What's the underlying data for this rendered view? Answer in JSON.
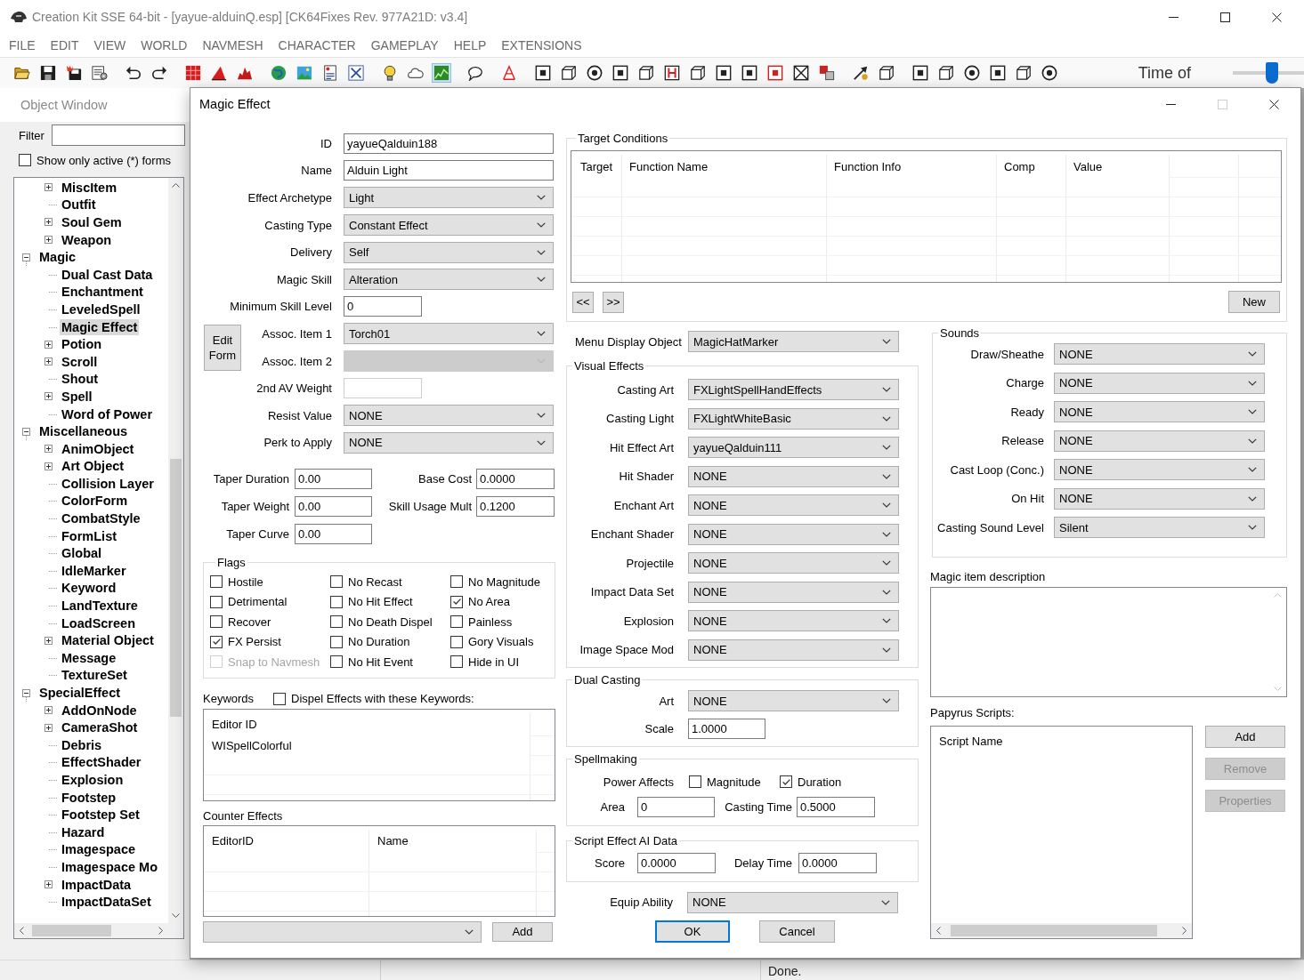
{
  "window": {
    "title": "Creation Kit SSE 64-bit - [yayue-alduinQ.esp] [CK64Fixes Rev. 977A21D: v3.4]"
  },
  "menu": [
    "FILE",
    "EDIT",
    "VIEW",
    "WORLD",
    "NAVMESH",
    "CHARACTER",
    "GAMEPLAY",
    "HELP",
    "EXTENSIONS"
  ],
  "toolbar": {
    "buttons": [
      {
        "pressed": false
      },
      {
        "pressed": false
      },
      {
        "pressed": false
      },
      {
        "pressed": false
      },
      {
        "pressed": false
      },
      {
        "pressed": false
      },
      {
        "pressed": false
      },
      {
        "pressed": false
      },
      {
        "pressed": false
      },
      {
        "pressed": false
      },
      {
        "pressed": false
      },
      {
        "pressed": false
      },
      {
        "pressed": false
      },
      {
        "pressed": false
      },
      {
        "pressed": false
      },
      {
        "pressed": true
      },
      {
        "pressed": false
      },
      {
        "pressed": false
      },
      {
        "pressed": false
      },
      {
        "pressed": false
      },
      {
        "pressed": false
      },
      {
        "pressed": false
      },
      {
        "pressed": false
      },
      {
        "pressed": false
      },
      {
        "pressed": false
      },
      {
        "pressed": false
      },
      {
        "pressed": false
      },
      {
        "pressed": false
      },
      {
        "pressed": false
      },
      {
        "pressed": false
      },
      {
        "pressed": false
      },
      {
        "pressed": false
      },
      {
        "pressed": false
      },
      {
        "pressed": false
      },
      {
        "pressed": false
      },
      {
        "pressed": false
      },
      {
        "pressed": false
      },
      {
        "pressed": false
      }
    ],
    "time_label": "Time of",
    "time_slider": {
      "level": 0.55
    }
  },
  "object_window": {
    "title": "Object Window",
    "filter": {
      "label": "Filter"
    },
    "active_only": {
      "label": "Show only active (*) forms",
      "checked": false
    },
    "tree": {
      "continued_items": [
        {
          "label": "MiscItem",
          "collapsed": true,
          "expanded": false,
          "selected": false
        },
        {
          "label": "Outfit",
          "collapsed": false,
          "expanded": false,
          "selected": false
        },
        {
          "label": "Soul Gem",
          "collapsed": true,
          "expanded": false,
          "selected": false
        },
        {
          "label": "Weapon",
          "collapsed": true,
          "expanded": false,
          "selected": false
        }
      ],
      "items": [
        {
          "label": "Magic",
          "collapsed": false,
          "expanded": true,
          "selected": false,
          "children": [
            {
              "label": "Dual Cast Data",
              "collapsed": false,
              "expanded": false,
              "selected": false
            },
            {
              "label": "Enchantment",
              "collapsed": false,
              "expanded": false,
              "selected": false
            },
            {
              "label": "LeveledSpell",
              "collapsed": false,
              "expanded": false,
              "selected": false
            },
            {
              "label": "Magic Effect",
              "collapsed": false,
              "expanded": false,
              "selected": true
            },
            {
              "label": "Potion",
              "collapsed": true,
              "expanded": false,
              "selected": false
            },
            {
              "label": "Scroll",
              "collapsed": true,
              "expanded": false,
              "selected": false
            },
            {
              "label": "Shout",
              "collapsed": false,
              "expanded": false,
              "selected": false
            },
            {
              "label": "Spell",
              "collapsed": true,
              "expanded": false,
              "selected": false
            },
            {
              "label": "Word of Power",
              "collapsed": false,
              "expanded": false,
              "selected": false
            }
          ]
        },
        {
          "label": "Miscellaneous",
          "collapsed": false,
          "expanded": true,
          "selected": false,
          "children": [
            {
              "label": "AnimObject",
              "collapsed": true,
              "expanded": false,
              "selected": false
            },
            {
              "label": "Art Object",
              "collapsed": true,
              "expanded": false,
              "selected": false
            },
            {
              "label": "Collision Layer",
              "collapsed": false,
              "expanded": false,
              "selected": false
            },
            {
              "label": "ColorForm",
              "collapsed": false,
              "expanded": false,
              "selected": false
            },
            {
              "label": "CombatStyle",
              "collapsed": false,
              "expanded": false,
              "selected": false
            },
            {
              "label": "FormList",
              "collapsed": false,
              "expanded": false,
              "selected": false
            },
            {
              "label": "Global",
              "collapsed": false,
              "expanded": false,
              "selected": false
            },
            {
              "label": "IdleMarker",
              "collapsed": false,
              "expanded": false,
              "selected": false
            },
            {
              "label": "Keyword",
              "collapsed": false,
              "expanded": false,
              "selected": false
            },
            {
              "label": "LandTexture",
              "collapsed": false,
              "expanded": false,
              "selected": false
            },
            {
              "label": "LoadScreen",
              "collapsed": false,
              "expanded": false,
              "selected": false
            },
            {
              "label": "Material Object",
              "collapsed": true,
              "expanded": false,
              "selected": false
            },
            {
              "label": "Message",
              "collapsed": false,
              "expanded": false,
              "selected": false
            },
            {
              "label": "TextureSet",
              "collapsed": false,
              "expanded": false,
              "selected": false
            }
          ]
        },
        {
          "label": "SpecialEffect",
          "collapsed": false,
          "expanded": true,
          "selected": false,
          "children": [
            {
              "label": "AddOnNode",
              "collapsed": true,
              "expanded": false,
              "selected": false
            },
            {
              "label": "CameraShot",
              "collapsed": true,
              "expanded": false,
              "selected": false
            },
            {
              "label": "Debris",
              "collapsed": false,
              "expanded": false,
              "selected": false
            },
            {
              "label": "EffectShader",
              "collapsed": false,
              "expanded": false,
              "selected": false
            },
            {
              "label": "Explosion",
              "collapsed": false,
              "expanded": false,
              "selected": false
            },
            {
              "label": "Footstep",
              "collapsed": false,
              "expanded": false,
              "selected": false
            },
            {
              "label": "Footstep Set",
              "collapsed": false,
              "expanded": false,
              "selected": false
            },
            {
              "label": "Hazard",
              "collapsed": false,
              "expanded": false,
              "selected": false
            },
            {
              "label": "Imagespace",
              "collapsed": false,
              "expanded": false,
              "selected": false
            },
            {
              "label": "Imagespace Mo",
              "collapsed": false,
              "expanded": false,
              "selected": false
            },
            {
              "label": "ImpactData",
              "collapsed": true,
              "expanded": false,
              "selected": false
            },
            {
              "label": "ImpactDataSet",
              "collapsed": false,
              "expanded": false,
              "selected": false
            }
          ]
        }
      ]
    }
  },
  "dialog": {
    "title": "Magic Effect",
    "fields_top": [
      {
        "kind": "input",
        "label": "ID",
        "value": "yayueQalduin188",
        "disabled": false
      },
      {
        "kind": "input",
        "label": "Name",
        "value": "Alduin Light",
        "disabled": false
      },
      {
        "kind": "dropdown",
        "label": "Effect Archetype",
        "value": "Light",
        "disabled": false
      },
      {
        "kind": "dropdown",
        "label": "Casting Type",
        "value": "Constant Effect",
        "disabled": false
      },
      {
        "kind": "dropdown",
        "label": "Delivery",
        "value": "Self",
        "disabled": false
      },
      {
        "kind": "dropdown",
        "label": "Magic Skill",
        "value": "Alteration",
        "disabled": false
      },
      {
        "kind": "short_input",
        "label": "Minimum Skill Level",
        "value": "0",
        "disabled": false
      }
    ],
    "assoc": {
      "button": "Edit Form",
      "fields": [
        {
          "kind": "dropdown",
          "label": "Assoc. Item 1",
          "value": "Torch01",
          "disabled": false
        },
        {
          "kind": "dropdown",
          "label": "Assoc. Item 2",
          "disabled": true
        }
      ]
    },
    "fields_bottom": [
      {
        "kind": "short_input",
        "label": "2nd AV Weight",
        "disabled": true
      },
      {
        "kind": "dropdown",
        "label": "Resist Value",
        "value": "NONE",
        "disabled": false
      },
      {
        "kind": "dropdown",
        "label": "Perk to Apply",
        "value": "NONE",
        "disabled": false
      }
    ],
    "costs": [
      {
        "label": "Taper Duration",
        "value": "0.00"
      },
      {
        "label": "Base Cost",
        "value": "0.0000"
      },
      {
        "label": "Taper Weight",
        "value": "0.00"
      },
      {
        "label": "Skill Usage Mult",
        "value": "0.1200"
      },
      {
        "label": "Taper Curve",
        "value": "0.00"
      }
    ],
    "flags": {
      "title": "Flags",
      "items": [
        {
          "label": "Hostile",
          "checked": false,
          "disabled": false
        },
        {
          "label": "No Recast",
          "checked": false,
          "disabled": false
        },
        {
          "label": "No Magnitude",
          "checked": false,
          "disabled": false
        },
        {
          "label": "Detrimental",
          "checked": false,
          "disabled": false
        },
        {
          "label": "No Hit Effect",
          "checked": false,
          "disabled": false
        },
        {
          "label": "No Area",
          "checked": true,
          "disabled": false
        },
        {
          "label": "Recover",
          "checked": false,
          "disabled": false
        },
        {
          "label": "No Death Dispel",
          "checked": false,
          "disabled": false
        },
        {
          "label": "Painless",
          "checked": false,
          "disabled": false
        },
        {
          "label": "FX Persist",
          "checked": true,
          "disabled": false
        },
        {
          "label": "No Duration",
          "checked": false,
          "disabled": false
        },
        {
          "label": "Gory Visuals",
          "checked": false,
          "disabled": false
        },
        {
          "label": "Snap to Navmesh",
          "checked": false,
          "disabled": true
        },
        {
          "label": "No Hit Event",
          "checked": false,
          "disabled": false
        },
        {
          "label": "Hide in UI",
          "checked": false,
          "disabled": false
        }
      ]
    },
    "keywords": {
      "label": "Keywords",
      "dispel": {
        "label": "Dispel Effects with these Keywords:",
        "checked": false
      },
      "columns": [
        "Editor ID"
      ],
      "rows": [
        "WISpellColorful"
      ]
    },
    "counter_effects": {
      "label": "Counter Effects",
      "columns": [
        "EditorID",
        "Name"
      ],
      "add_button": "Add"
    },
    "target_conditions": {
      "title": "Target Conditions",
      "columns": [
        "Target",
        "Function Name",
        "Function Info",
        "Comp",
        "Value"
      ],
      "prev_button": "<<",
      "next_button": ">>",
      "new_button": "New"
    },
    "menu_display_object": {
      "label": "Menu Display Object",
      "value": "MagicHatMarker"
    },
    "visual_effects": {
      "title": "Visual Effects",
      "fields": [
        {
          "label": "Casting Art",
          "value": "FXLightSpellHandEffects"
        },
        {
          "label": "Casting Light",
          "value": "FXLightWhiteBasic"
        },
        {
          "label": "Hit Effect Art",
          "value": "yayueQalduin111"
        },
        {
          "label": "Hit Shader",
          "value": "NONE"
        },
        {
          "label": "Enchant Art",
          "value": "NONE"
        },
        {
          "label": "Enchant Shader",
          "value": "NONE"
        },
        {
          "label": "Projectile",
          "value": "NONE"
        },
        {
          "label": "Impact Data Set",
          "value": "NONE"
        },
        {
          "label": "Explosion",
          "value": "NONE"
        },
        {
          "label": "Image Space Mod",
          "value": "NONE"
        }
      ]
    },
    "dual_casting": {
      "title": "Dual Casting",
      "art": {
        "label": "Art",
        "value": "NONE"
      },
      "scale": {
        "label": "Scale",
        "value": "1.0000"
      }
    },
    "spellmaking": {
      "title": "Spellmaking",
      "power_affects": {
        "label": "Power Affects",
        "options": [
          {
            "label": "Magnitude",
            "checked": false
          },
          {
            "label": "Duration",
            "checked": true
          }
        ]
      },
      "area": {
        "label": "Area",
        "value": "0"
      },
      "casting_time": {
        "label": "Casting Time",
        "value": "0.5000"
      }
    },
    "script_effect_ai": {
      "title": "Script Effect AI Data",
      "score": {
        "label": "Score",
        "value": "0.0000"
      },
      "delay_time": {
        "label": "Delay Time",
        "value": "0.0000"
      }
    },
    "equip_ability": {
      "label": "Equip Ability",
      "value": "NONE"
    },
    "actions": [
      {
        "label": "OK",
        "default": true
      },
      {
        "label": "Cancel",
        "default": false
      }
    ],
    "sounds": {
      "title": "Sounds",
      "fields": [
        {
          "label": "Draw/Sheathe",
          "value": "NONE"
        },
        {
          "label": "Charge",
          "value": "NONE"
        },
        {
          "label": "Ready",
          "value": "NONE"
        },
        {
          "label": "Release",
          "value": "NONE"
        },
        {
          "label": "Cast Loop (Conc.)",
          "value": "NONE"
        },
        {
          "label": "On Hit",
          "value": "NONE"
        },
        {
          "label": "Casting Sound Level",
          "value": "Silent"
        }
      ]
    },
    "description": {
      "label": "Magic item description"
    },
    "papyrus_scripts": {
      "label": "Papyrus Scripts:",
      "columns": [
        "Script Name"
      ],
      "buttons": [
        {
          "label": "Add",
          "disabled": false
        },
        {
          "label": "Remove",
          "disabled": true
        },
        {
          "label": "Properties",
          "disabled": true
        }
      ]
    }
  },
  "status_bar": {
    "text": "Done."
  }
}
